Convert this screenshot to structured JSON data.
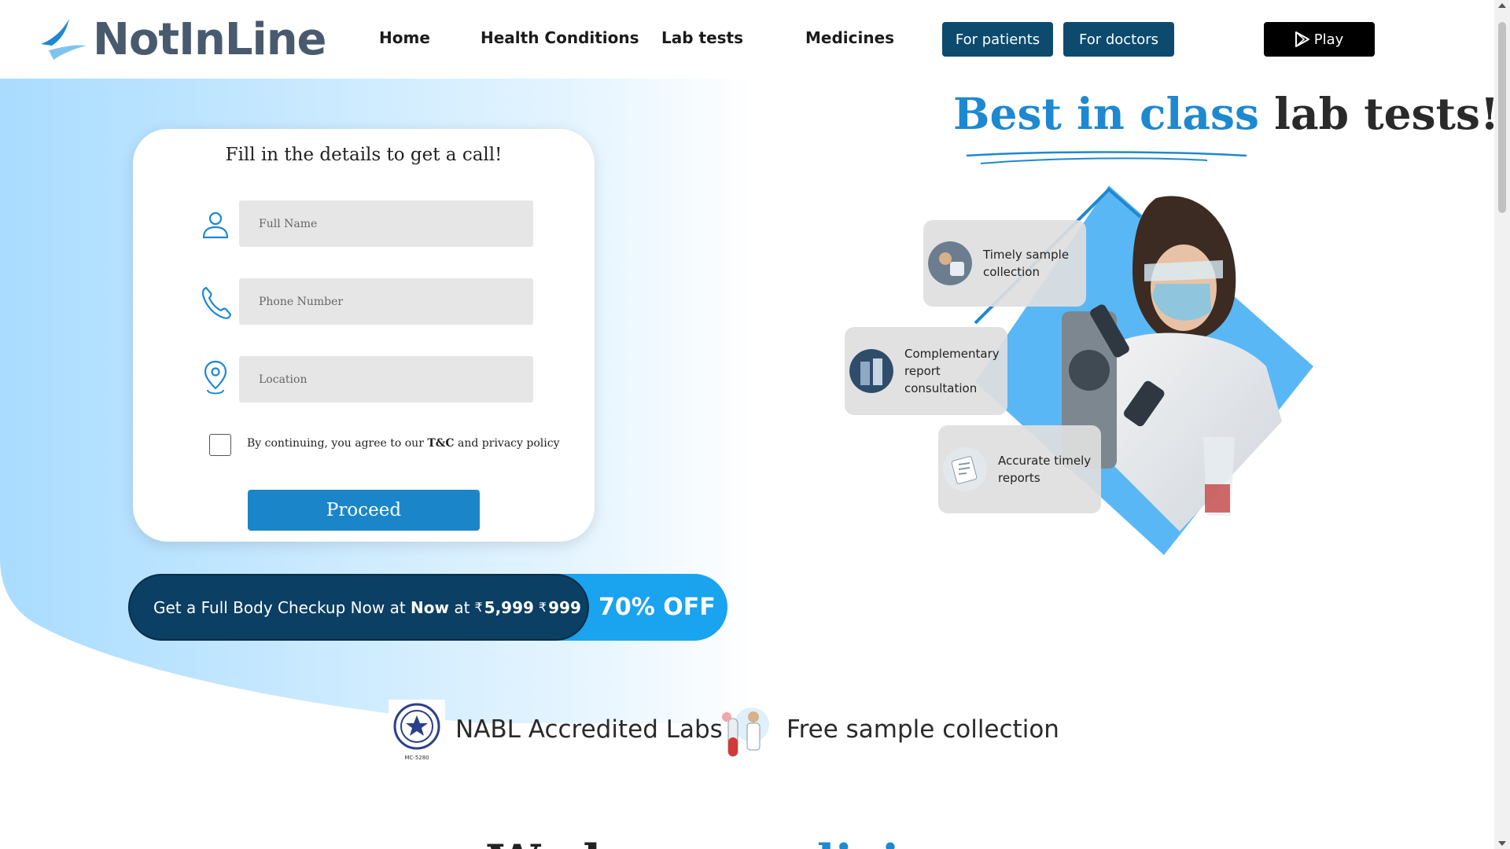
{
  "brand": {
    "name": "NotInLine"
  },
  "nav": {
    "items": [
      "Home",
      "Health Conditions",
      "Lab tests",
      "Medicines"
    ],
    "for_patients": "For patients",
    "for_doctors": "For doctors",
    "play": "Play"
  },
  "form": {
    "title": "Fill in the details to get a call!",
    "full_name_placeholder": "Full Name",
    "phone_placeholder": "Phone Number",
    "location_placeholder": "Location",
    "agree_prefix": "By continuing, you agree to our ",
    "agree_tc": "T&C",
    "agree_suffix": " and privacy policy",
    "proceed": "Proceed"
  },
  "offer": {
    "text_prefix": "Get a Full Body Checkup Now at",
    "now": "Now",
    "at": "at",
    "currency": "₹",
    "old_price": "5,999",
    "new_price": "999",
    "discount": "70% OFF"
  },
  "hero": {
    "headline_blue": "Best in class",
    "headline_dark": "lab tests!",
    "features": [
      {
        "label": "Timely sample collection",
        "icon": "sample-collection-thumb"
      },
      {
        "label": "Complementary report consultation",
        "icon": "consultation-thumb"
      },
      {
        "label": "Accurate timely reports",
        "icon": "reports-thumb"
      }
    ]
  },
  "badges": {
    "nabl": "NABL Accredited Labs",
    "nabl_code": "MC-5280",
    "free_sample": "Free sample collection"
  },
  "section_heading": {
    "dark": "We have ",
    "blue": "medicines"
  },
  "colors": {
    "primary": "#1a86c9",
    "dark_blue": "#0c4a6e",
    "accent": "#1aa3ef",
    "logo_gray": "#4a5a6e"
  }
}
